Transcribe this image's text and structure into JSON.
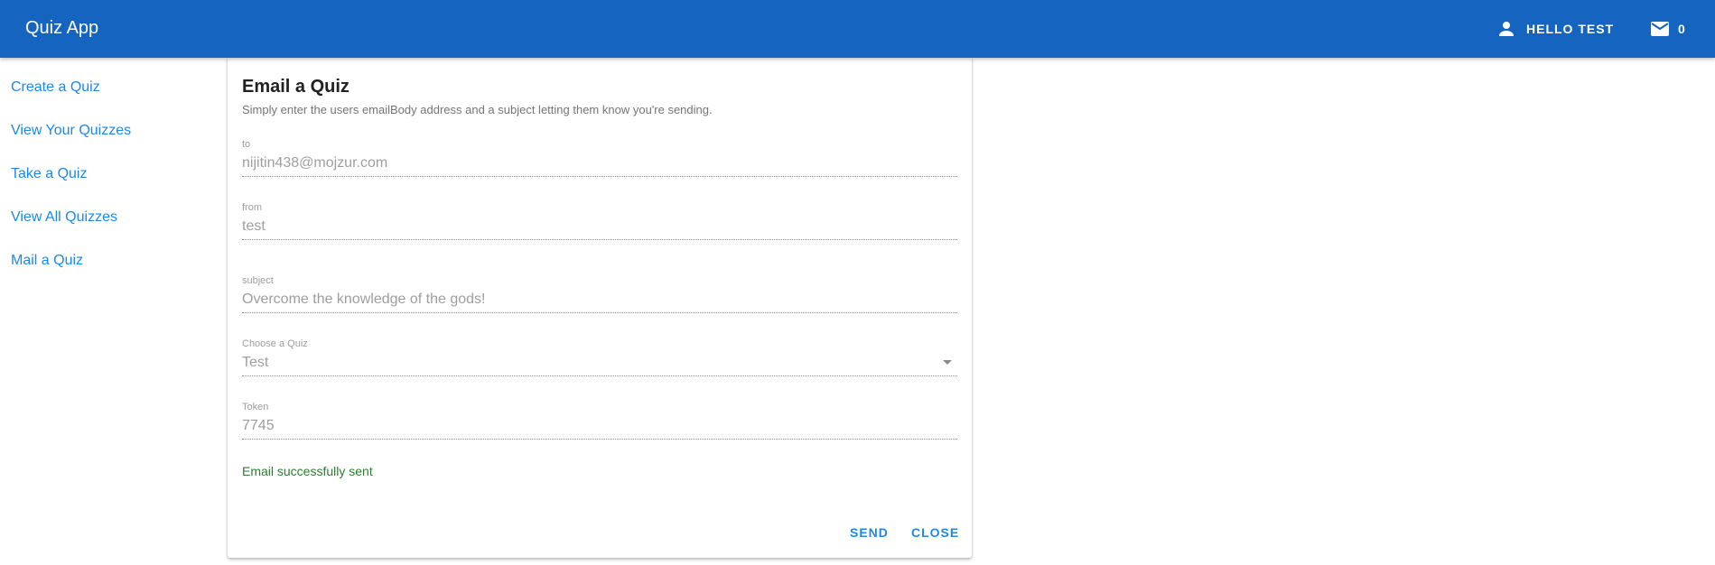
{
  "app": {
    "title": "Quiz App",
    "user_label": "HELLO TEST",
    "mail_count": "0",
    "icons": {
      "user": "person-icon",
      "mail": "mail-icon"
    },
    "colors": {
      "appbar": "#1565c0",
      "link": "#1e88e5",
      "success": "#2e7d32"
    }
  },
  "sidebar": {
    "items": [
      {
        "label": "Create a Quiz"
      },
      {
        "label": "View Your Quizzes"
      },
      {
        "label": "Take a Quiz"
      },
      {
        "label": "View All Quizzes"
      },
      {
        "label": "Mail a Quiz"
      }
    ]
  },
  "dialog": {
    "title": "Email a Quiz",
    "subtitle": "Simply enter the users emailBody address and a subject letting them know you're sending.",
    "fields": {
      "to": {
        "label": "to",
        "value": "nijitin438@mojzur.com"
      },
      "from": {
        "label": "from",
        "value": "test"
      },
      "subject": {
        "label": "subject",
        "value": "Overcome the knowledge of the gods!"
      },
      "quiz": {
        "label": "Choose a Quiz",
        "value": "Test",
        "icon": "dropdown-arrow-icon"
      },
      "token": {
        "label": "Token",
        "value": "7745"
      }
    },
    "status": "Email successfully sent",
    "actions": {
      "send": "SEND",
      "close": "CLOSE"
    }
  }
}
